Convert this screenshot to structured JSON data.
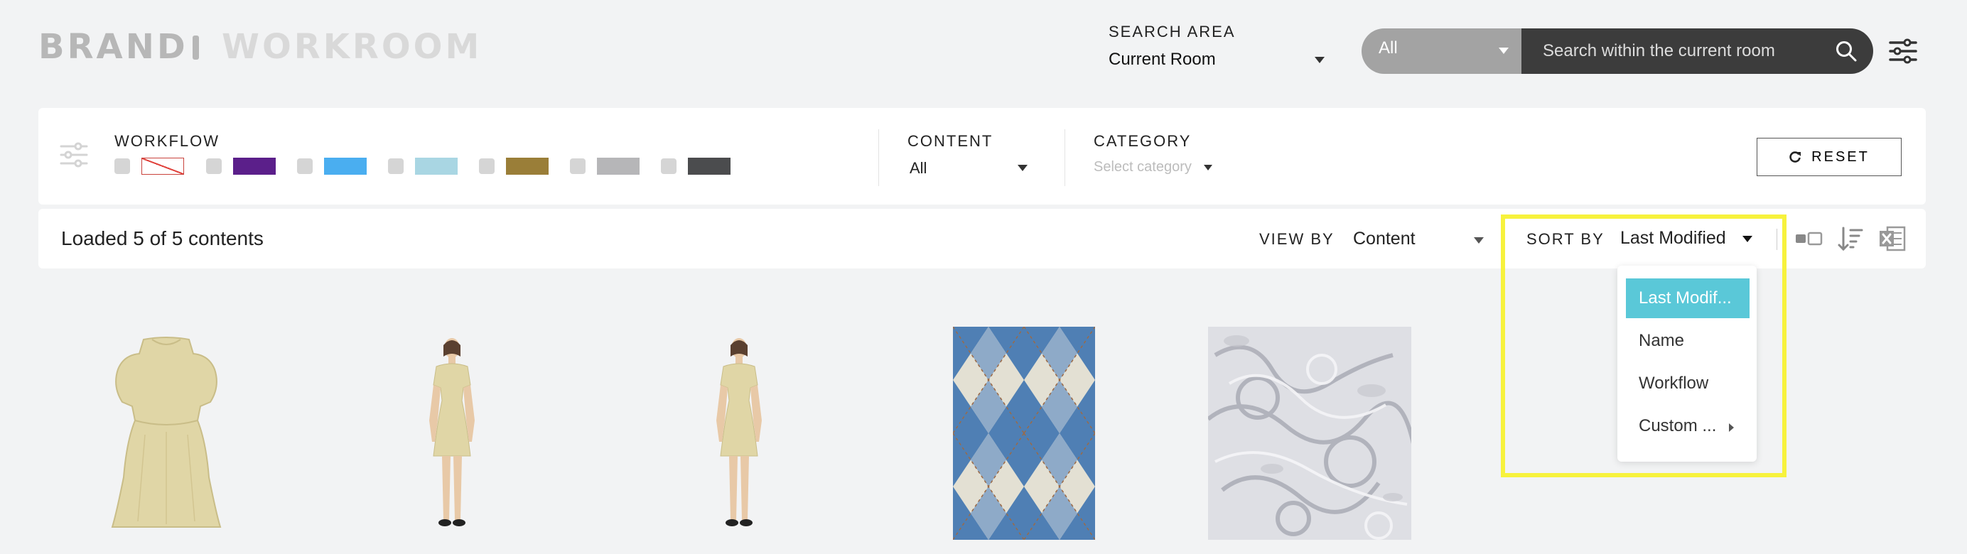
{
  "header": {
    "brand": "BRAND",
    "workroom": "WORKROOM",
    "search_area_label": "SEARCH AREA",
    "search_area_value": "Current Room",
    "search_scope": "All",
    "search_placeholder": "Search within the current room"
  },
  "filters": {
    "workflow_label": "WORKFLOW",
    "workflow_colors": [
      "none",
      "#5b1f8a",
      "#4aaef0",
      "#a9d6e3",
      "#9a7e38",
      "#b6b6b8",
      "#4b4c4e"
    ],
    "content_label": "CONTENT",
    "content_value": "All",
    "category_label": "CATEGORY",
    "category_placeholder": "Select category",
    "reset_label": "RESET"
  },
  "toolbar": {
    "loaded_text": "Loaded 5 of 5 contents",
    "view_by_label": "VIEW BY",
    "view_by_value": "Content",
    "sort_by_label": "SORT BY",
    "sort_by_value": "Last Modified"
  },
  "sort_dropdown": {
    "options": [
      "Last Modif...",
      "Name",
      "Workflow",
      "Custom ..."
    ],
    "selected": "Last Modif..."
  },
  "thumbnails": [
    {
      "kind": "dress-garment"
    },
    {
      "kind": "avatar-dress"
    },
    {
      "kind": "avatar-dress"
    },
    {
      "kind": "argyle-fabric"
    },
    {
      "kind": "grey-floral-fabric"
    }
  ],
  "colors": {
    "highlight": "#f7f23c",
    "dropdown_active": "#5ac8d8",
    "search_dark": "#3c3c3c",
    "search_scope_bg": "#a3a3a3"
  }
}
